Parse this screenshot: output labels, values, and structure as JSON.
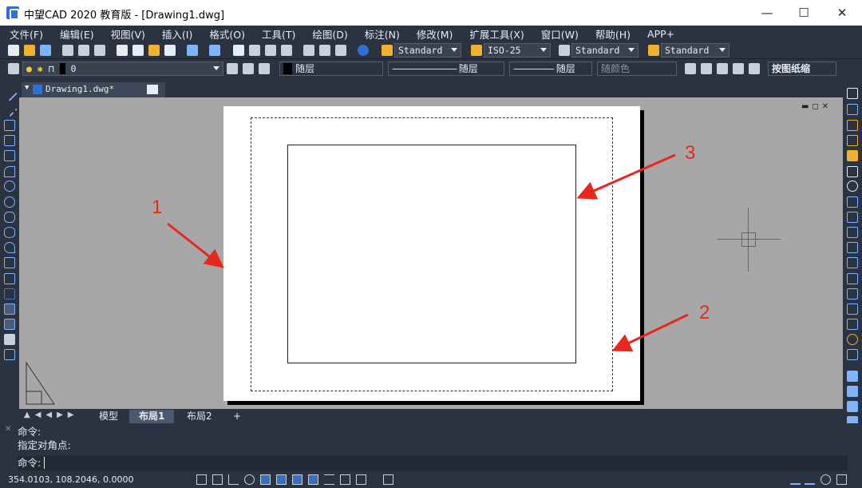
{
  "window": {
    "title": "中望CAD 2020 教育版 - [Drawing1.dwg]",
    "minimize": "—",
    "maximize": "☐",
    "close": "✕"
  },
  "menu": [
    "文件(F)",
    "编辑(E)",
    "视图(V)",
    "插入(I)",
    "格式(O)",
    "工具(T)",
    "绘图(D)",
    "标注(N)",
    "修改(M)",
    "扩展工具(X)",
    "窗口(W)",
    "帮助(H)",
    "APP+"
  ],
  "toolbar": {
    "text_style": "Standard",
    "dim_style": "ISO-25",
    "table_style": "Standard",
    "mleader_style": "Standard"
  },
  "layers": {
    "current_layer": "0",
    "color": "随层",
    "linetype": "随层",
    "lineweight": "随层",
    "plotstyle": "随颜色",
    "scale_mode": "按图纸缩"
  },
  "doc_tab": {
    "name": "Drawing1.dwg*",
    "close": "✕"
  },
  "annotations": {
    "a1": "1",
    "a2": "2",
    "a3": "3"
  },
  "layout_tabs": [
    "模型",
    "布局1",
    "布局2",
    "+"
  ],
  "command": {
    "line1": "命令:",
    "line2": "指定对角点:",
    "prompt": "命令:"
  },
  "status": {
    "coords": "354.0103, 108.2046, 0.0000"
  },
  "colors": {
    "accent": "#2f6fd6",
    "background": "#2b3240",
    "canvas": "#a7a7a7",
    "annotation": "#e8281e"
  }
}
